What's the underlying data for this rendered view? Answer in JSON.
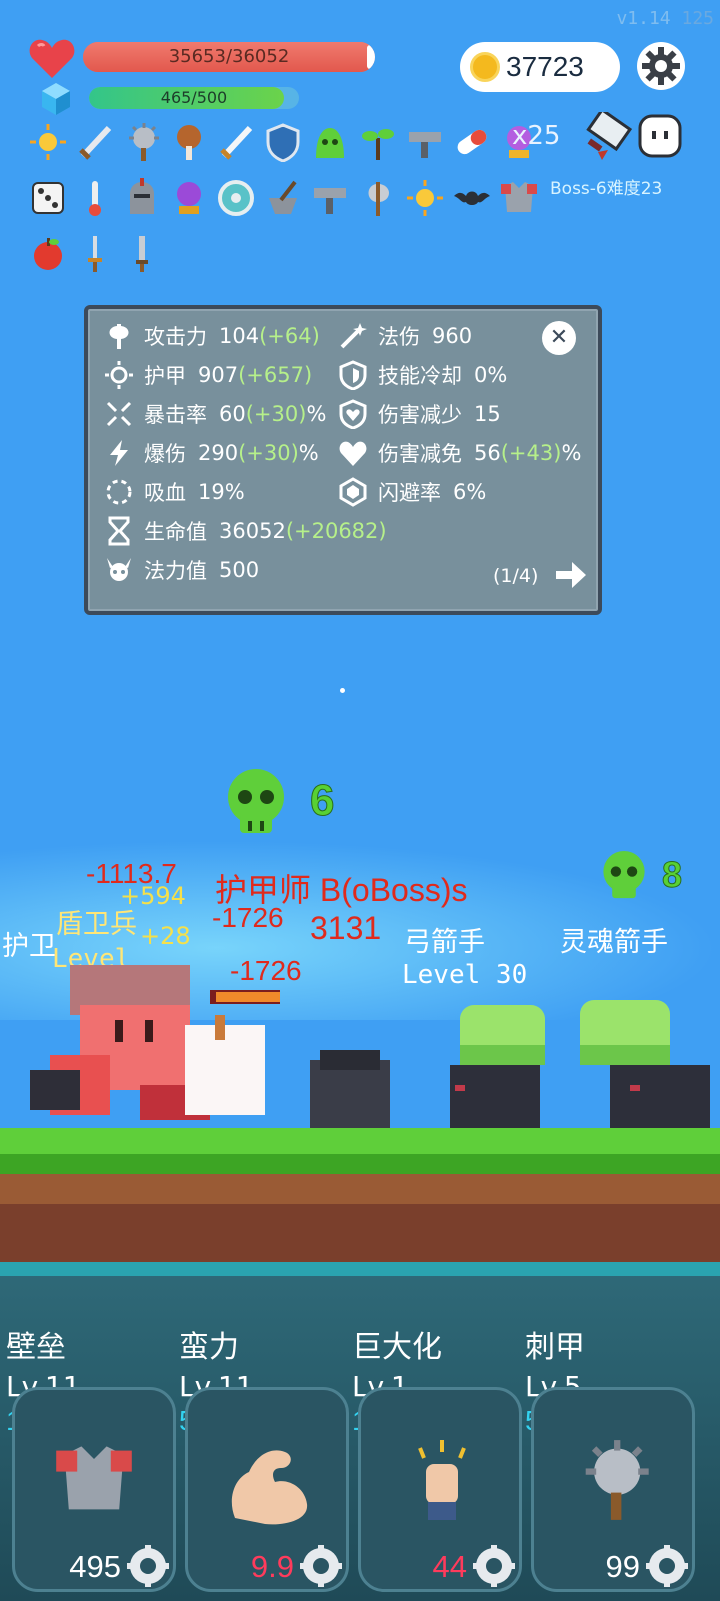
{
  "version": {
    "label": "v1.14",
    "build": "125"
  },
  "hud": {
    "hp_text": "35653/36052",
    "hp_fraction": 0.989,
    "mp_text": "465/500",
    "mp_fraction": 0.93,
    "gold": "37723"
  },
  "items": {
    "row1": [
      "sun-orb-icon",
      "sword-icon",
      "spiked-mace-icon",
      "meat-drumstick-icon",
      "steel-sword-icon",
      "shield-icon",
      "green-slime-icon",
      "sapling-icon",
      "uzi-gun-icon",
      "pill-capsule-icon",
      "crystal-ball-icon"
    ],
    "row2": [
      "dice-icon",
      "thermometer-icon",
      "knight-helmet-icon",
      "magic-orb-icon",
      "round-shield-icon",
      "mortar-pestle-icon",
      "uzi-gun-icon",
      "battle-axe-icon",
      "sun-orb-icon",
      "bat-icon",
      "chest-armor-icon"
    ],
    "row3": [
      "apple-icon",
      "dagger-icon",
      "short-sword-icon"
    ],
    "multiplier": "x25",
    "boss_tag": "Boss-6难度23"
  },
  "stats": {
    "left": [
      {
        "icon": "axe-icon",
        "name": "攻击力",
        "value": "104",
        "bonus": "(+64)",
        "suffix": ""
      },
      {
        "icon": "sun-icon",
        "name": "护甲",
        "value": "907",
        "bonus": "(+657)",
        "suffix": ""
      },
      {
        "icon": "crosshair-icon",
        "name": "暴击率",
        "value": "60",
        "bonus": "(+30)",
        "suffix": "%"
      },
      {
        "icon": "lightning-icon",
        "name": "爆伤",
        "value": "290",
        "bonus": "(+30)",
        "suffix": "%"
      },
      {
        "icon": "lifesteal-icon",
        "name": "吸血",
        "value": "19%",
        "bonus": "",
        "suffix": ""
      },
      {
        "icon": "hourglass-icon",
        "name": "生命值",
        "value": "36052",
        "bonus": "(+20682)",
        "suffix": ""
      },
      {
        "icon": "horned-skull-icon",
        "name": "法力值",
        "value": "500",
        "bonus": "",
        "suffix": ""
      }
    ],
    "right": [
      {
        "icon": "magic-wand-icon",
        "name": "法伤",
        "value": "960",
        "bonus": "",
        "suffix": ""
      },
      {
        "icon": "shield-outline-icon",
        "name": "技能冷却",
        "value": "0%",
        "bonus": "",
        "suffix": ""
      },
      {
        "icon": "heart-shield-icon",
        "name": "伤害减少",
        "value": "15",
        "bonus": "",
        "suffix": ""
      },
      {
        "icon": "heart-icon",
        "name": "伤害减免",
        "value": "56",
        "bonus": "(+43)",
        "suffix": "%"
      },
      {
        "icon": "hexagon-dodge-icon",
        "name": "闪避率",
        "value": "6%",
        "bonus": "",
        "suffix": ""
      }
    ],
    "close": "✕",
    "page": "(1/4)"
  },
  "battle": {
    "kill_count_main": "6",
    "kill_count_side": "8",
    "enemy_names": [
      "盾卫兵",
      "弓箭手",
      "灵魂箭手",
      "护卫",
      "护甲师 B(oBoss)s"
    ],
    "enemy_level": "Level 30",
    "level_prefix_left": "Level",
    "damage": [
      "-1113.7",
      "-1726",
      "-1726",
      "3131"
    ],
    "heal": [
      "+594",
      "+28"
    ]
  },
  "skills": [
    {
      "name": "壁垒",
      "level": "Lv.11",
      "points": "10",
      "cost": "495",
      "cost_color": "#ffffff",
      "icon": "chest-armor-icon"
    },
    {
      "name": "蛮力",
      "level": "Lv.11",
      "points": "5",
      "cost": "9.9",
      "cost_color": "#ff3b5c",
      "icon": "flexed-arm-icon"
    },
    {
      "name": "巨大化",
      "level": "Lv.1",
      "points": "15",
      "cost": "44",
      "cost_color": "#ff3b5c",
      "icon": "fist-icon"
    },
    {
      "name": "刺甲",
      "level": "Lv.5",
      "points": "5",
      "cost": "99",
      "cost_color": "#ffffff",
      "icon": "spiked-mace-icon"
    }
  ]
}
